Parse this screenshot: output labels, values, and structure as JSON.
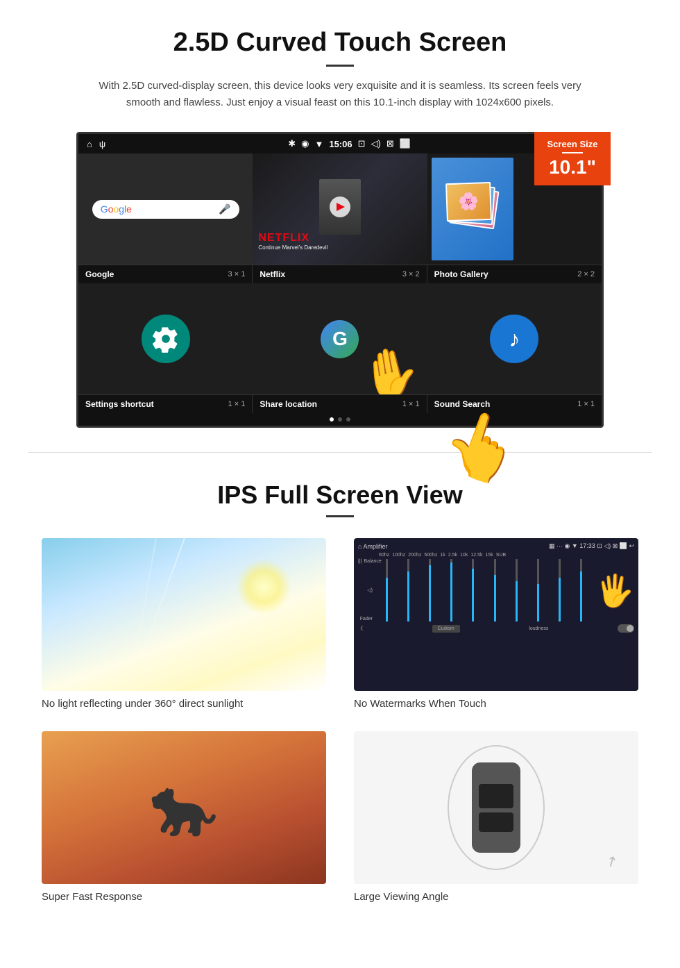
{
  "section1": {
    "title": "2.5D Curved Touch Screen",
    "description": "With 2.5D curved-display screen, this device looks very exquisite and it is seamless. Its screen feels very smooth and flawless. Just enjoy a visual feast on this 10.1-inch display with 1024x600 pixels.",
    "screen_size_badge": {
      "label": "Screen Size",
      "size": "10.1\""
    },
    "status_bar": {
      "time": "15:06"
    },
    "apps": [
      {
        "name": "Google",
        "size": "3 × 1"
      },
      {
        "name": "Netflix",
        "size": "3 × 2"
      },
      {
        "name": "Photo Gallery",
        "size": "2 × 2"
      },
      {
        "name": "Settings shortcut",
        "size": "1 × 1"
      },
      {
        "name": "Share location",
        "size": "1 × 1"
      },
      {
        "name": "Sound Search",
        "size": "1 × 1"
      }
    ],
    "netflix_text": "NETFLIX",
    "netflix_subtitle": "Continue Marvel's Daredevil"
  },
  "section2": {
    "title": "IPS Full Screen View",
    "features": [
      {
        "label": "No light reflecting under 360° direct sunlight",
        "image_type": "sky"
      },
      {
        "label": "No Watermarks When Touch",
        "image_type": "amplifier"
      },
      {
        "label": "Super Fast Response",
        "image_type": "cheetah"
      },
      {
        "label": "Large Viewing Angle",
        "image_type": "car"
      }
    ]
  }
}
